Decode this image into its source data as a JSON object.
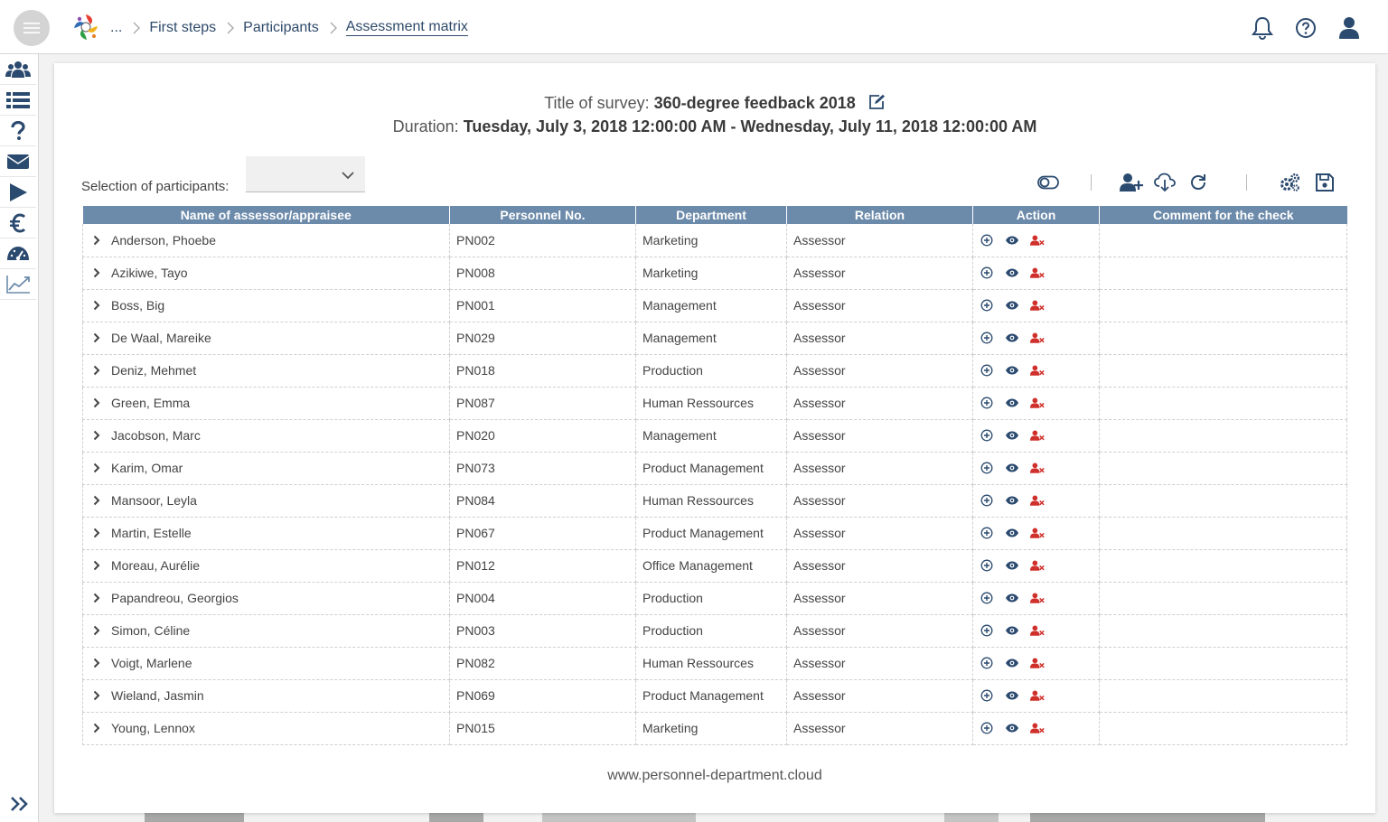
{
  "breadcrumb": {
    "ellipsis": "...",
    "items": [
      "First steps",
      "Participants",
      "Assessment matrix"
    ]
  },
  "survey": {
    "title_label": "Title of survey:",
    "title_value": "360-degree feedback 2018",
    "duration_label": "Duration:",
    "duration_value": "Tuesday, July 3, 2018 12:00:00 AM - Wednesday, July 11, 2018 12:00:00 AM"
  },
  "selection": {
    "label": "Selection of participants:",
    "value": ""
  },
  "table": {
    "headers": [
      "Name of assessor/appraisee",
      "Personnel No.",
      "Department",
      "Relation",
      "Action",
      "Comment for the check"
    ],
    "rows": [
      {
        "name": "Anderson, Phoebe",
        "pn": "PN002",
        "dept": "Marketing",
        "relation": "Assessor",
        "comment": ""
      },
      {
        "name": "Azikiwe, Tayo",
        "pn": "PN008",
        "dept": "Marketing",
        "relation": "Assessor",
        "comment": ""
      },
      {
        "name": "Boss, Big",
        "pn": "PN001",
        "dept": "Management",
        "relation": "Assessor",
        "comment": ""
      },
      {
        "name": "De Waal, Mareike",
        "pn": "PN029",
        "dept": "Management",
        "relation": "Assessor",
        "comment": ""
      },
      {
        "name": "Deniz, Mehmet",
        "pn": "PN018",
        "dept": "Production",
        "relation": "Assessor",
        "comment": ""
      },
      {
        "name": "Green, Emma",
        "pn": "PN087",
        "dept": "Human Ressources",
        "relation": "Assessor",
        "comment": ""
      },
      {
        "name": "Jacobson, Marc",
        "pn": "PN020",
        "dept": "Management",
        "relation": "Assessor",
        "comment": ""
      },
      {
        "name": "Karim, Omar",
        "pn": "PN073",
        "dept": "Product Management",
        "relation": "Assessor",
        "comment": ""
      },
      {
        "name": "Mansoor, Leyla",
        "pn": "PN084",
        "dept": "Human Ressources",
        "relation": "Assessor",
        "comment": ""
      },
      {
        "name": "Martin, Estelle",
        "pn": "PN067",
        "dept": "Product Management",
        "relation": "Assessor",
        "comment": ""
      },
      {
        "name": "Moreau, Aurélie",
        "pn": "PN012",
        "dept": "Office Management",
        "relation": "Assessor",
        "comment": ""
      },
      {
        "name": "Papandreou, Georgios",
        "pn": "PN004",
        "dept": "Production",
        "relation": "Assessor",
        "comment": ""
      },
      {
        "name": "Simon, Céline",
        "pn": "PN003",
        "dept": "Production",
        "relation": "Assessor",
        "comment": ""
      },
      {
        "name": "Voigt, Marlene",
        "pn": "PN082",
        "dept": "Human Ressources",
        "relation": "Assessor",
        "comment": ""
      },
      {
        "name": "Wieland, Jasmin",
        "pn": "PN069",
        "dept": "Product Management",
        "relation": "Assessor",
        "comment": ""
      },
      {
        "name": "Young, Lennox",
        "pn": "PN015",
        "dept": "Marketing",
        "relation": "Assessor",
        "comment": ""
      }
    ]
  },
  "footer": {
    "url": "www.personnel-department.cloud"
  },
  "sidebar": {
    "icons": [
      "users-icon",
      "list-icon",
      "question-icon",
      "envelope-icon",
      "play-icon",
      "euro-icon",
      "dashboard-icon",
      "chart-line-icon"
    ]
  },
  "colors": {
    "header_bg": "#6c8aaa",
    "nav_icon": "#2b4a6f",
    "delete_icon": "#d0302b",
    "breadcrumb_text": "#2e4a6a"
  }
}
